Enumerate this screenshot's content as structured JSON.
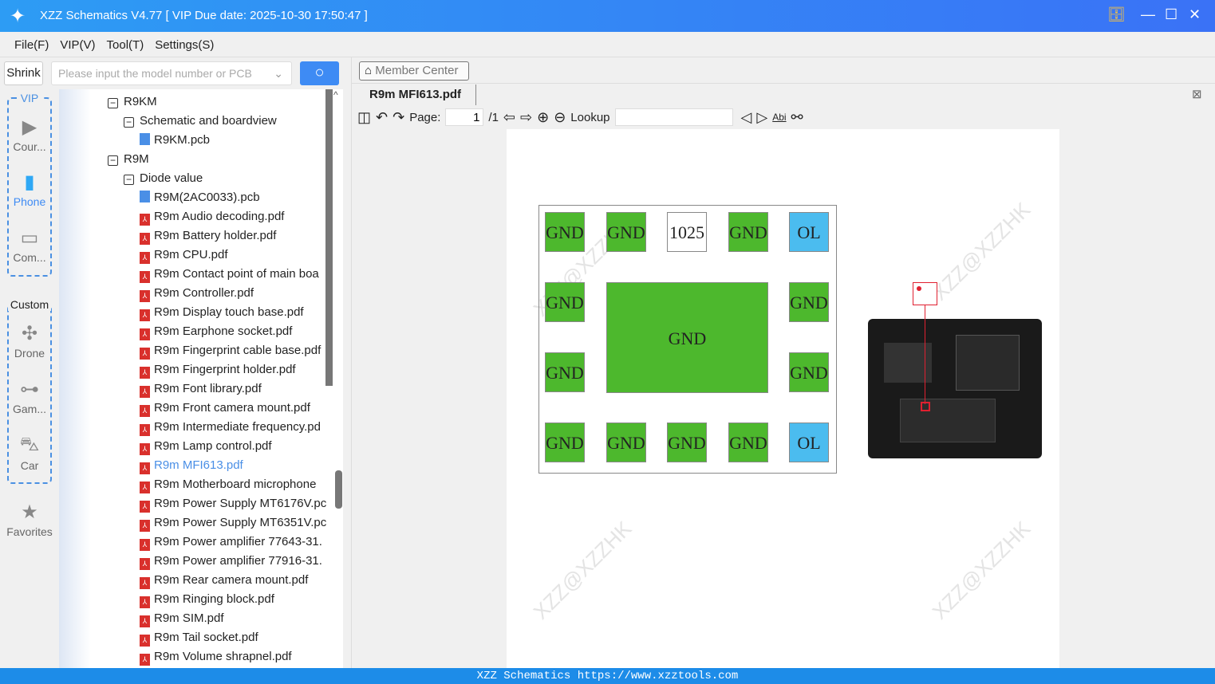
{
  "window": {
    "title": "XZZ Schematics V4.77 [ VIP Due date: 2025-10-30 17:50:47 ]"
  },
  "menu": [
    "File(F)",
    "VIP(V)",
    "Tool(T)",
    "Settings(S)"
  ],
  "search": {
    "shrink_label": "Shrink",
    "placeholder": "Please input the model number or PCB"
  },
  "sidebar": {
    "vip_label": "VIP",
    "custom_label": "Custom",
    "items": [
      "Cour...",
      "Phone",
      "Com...",
      "Drone",
      "Gam...",
      "Car",
      "Favorites"
    ]
  },
  "tree": [
    {
      "label": "R9KM",
      "level": 0,
      "kind": "folder"
    },
    {
      "label": "Schematic and boardview",
      "level": 1,
      "kind": "folder"
    },
    {
      "label": "R9KM.pcb",
      "level": 2,
      "kind": "pcb"
    },
    {
      "label": "R9M",
      "level": 0,
      "kind": "folder"
    },
    {
      "label": "Diode value",
      "level": 1,
      "kind": "folder"
    },
    {
      "label": "R9M(2AC0033).pcb",
      "level": 2,
      "kind": "pcb"
    },
    {
      "label": "R9m Audio decoding.pdf",
      "level": 2,
      "kind": "pdf"
    },
    {
      "label": "R9m Battery holder.pdf",
      "level": 2,
      "kind": "pdf"
    },
    {
      "label": "R9m CPU.pdf",
      "level": 2,
      "kind": "pdf"
    },
    {
      "label": "R9m Contact point of main boa",
      "level": 2,
      "kind": "pdf"
    },
    {
      "label": "R9m Controller.pdf",
      "level": 2,
      "kind": "pdf"
    },
    {
      "label": "R9m Display touch base.pdf",
      "level": 2,
      "kind": "pdf"
    },
    {
      "label": "R9m Earphone socket.pdf",
      "level": 2,
      "kind": "pdf"
    },
    {
      "label": "R9m Fingerprint cable base.pdf",
      "level": 2,
      "kind": "pdf"
    },
    {
      "label": "R9m Fingerprint holder.pdf",
      "level": 2,
      "kind": "pdf"
    },
    {
      "label": "R9m Font library.pdf",
      "level": 2,
      "kind": "pdf"
    },
    {
      "label": "R9m Front camera mount.pdf",
      "level": 2,
      "kind": "pdf"
    },
    {
      "label": "R9m Intermediate frequency.pd",
      "level": 2,
      "kind": "pdf"
    },
    {
      "label": "R9m Lamp control.pdf",
      "level": 2,
      "kind": "pdf"
    },
    {
      "label": "R9m MFI613.pdf",
      "level": 2,
      "kind": "pdf",
      "selected": true
    },
    {
      "label": "R9m Motherboard microphone",
      "level": 2,
      "kind": "pdf"
    },
    {
      "label": "R9m Power Supply MT6176V.pc",
      "level": 2,
      "kind": "pdf"
    },
    {
      "label": "R9m Power Supply MT6351V.pc",
      "level": 2,
      "kind": "pdf"
    },
    {
      "label": "R9m Power amplifier 77643-31.",
      "level": 2,
      "kind": "pdf"
    },
    {
      "label": "R9m Power amplifier 77916-31.",
      "level": 2,
      "kind": "pdf"
    },
    {
      "label": "R9m Rear camera mount.pdf",
      "level": 2,
      "kind": "pdf"
    },
    {
      "label": "R9m Ringing block.pdf",
      "level": 2,
      "kind": "pdf"
    },
    {
      "label": "R9m SIM.pdf",
      "level": 2,
      "kind": "pdf"
    },
    {
      "label": "R9m Tail socket.pdf",
      "level": 2,
      "kind": "pdf"
    },
    {
      "label": "R9m Volume shrapnel.pdf",
      "level": 2,
      "kind": "pdf"
    }
  ],
  "viewer": {
    "member_center": "Member Center",
    "tab": "R9m MFI613.pdf",
    "page_label": "Page:",
    "page_value": "1",
    "page_total": "/1",
    "lookup_label": "Lookup",
    "abi": "Abi"
  },
  "pads": [
    [
      "GND",
      "GND",
      "1025",
      "GND",
      "OL"
    ],
    [
      "GND",
      "",
      "",
      "",
      "GND"
    ],
    [
      "GND",
      "",
      "",
      "",
      "GND"
    ],
    [
      "GND",
      "GND",
      "GND",
      "GND",
      "OL"
    ]
  ],
  "center_pad": "GND",
  "watermark": "XZZ@XZZHK",
  "status": "XZZ Schematics https://www.xzztools.com",
  "colors": {
    "accent": "#3e8bf4",
    "selected": "#4a8fe6",
    "pad_green": "#4db82d",
    "pad_blue": "#4bbcef"
  }
}
